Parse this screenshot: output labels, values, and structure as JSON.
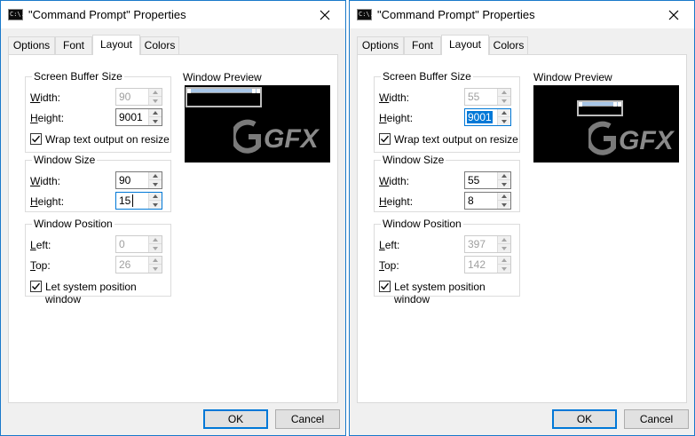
{
  "dialogs": [
    {
      "title": "\"Command Prompt\" Properties",
      "app_icon_text": "C:\\.",
      "tabs": [
        "Options",
        "Font",
        "Layout",
        "Colors"
      ],
      "active_tab": "Layout",
      "screen_buffer": {
        "title": "Screen Buffer Size",
        "width_label": "Width:",
        "width_value": "90",
        "height_label": "Height:",
        "height_value": "9001",
        "wrap_label": "Wrap text output on resize",
        "wrap_checked": true
      },
      "window_size": {
        "title": "Window Size",
        "width_label": "Width:",
        "width_value": "90",
        "height_label": "Height:",
        "height_value": "15"
      },
      "window_position": {
        "title": "Window Position",
        "left_label": "Left:",
        "left_value": "0",
        "top_label": "Top:",
        "top_value": "26",
        "let_system_label": "Let system position window",
        "let_system_checked": true
      },
      "preview": {
        "label": "Window Preview",
        "watermark": "GFX"
      },
      "buttons": {
        "ok": "OK",
        "cancel": "Cancel"
      }
    },
    {
      "title": "\"Command Prompt\" Properties",
      "app_icon_text": "C:\\.",
      "tabs": [
        "Options",
        "Font",
        "Layout",
        "Colors"
      ],
      "active_tab": "Layout",
      "screen_buffer": {
        "title": "Screen Buffer Size",
        "width_label": "Width:",
        "width_value": "55",
        "height_label": "Height:",
        "height_value": "9001",
        "wrap_label": "Wrap text output on resize",
        "wrap_checked": true
      },
      "window_size": {
        "title": "Window Size",
        "width_label": "Width:",
        "width_value": "55",
        "height_label": "Height:",
        "height_value": "8"
      },
      "window_position": {
        "title": "Window Position",
        "left_label": "Left:",
        "left_value": "397",
        "top_label": "Top:",
        "top_value": "142",
        "let_system_label": "Let system position window",
        "let_system_checked": true
      },
      "preview": {
        "label": "Window Preview",
        "watermark": "GFX"
      },
      "buttons": {
        "ok": "OK",
        "cancel": "Cancel"
      }
    }
  ],
  "colors": {
    "accent": "#0078d7",
    "window_border": "#1979ca",
    "dialog_bg": "#f0f0f0"
  }
}
